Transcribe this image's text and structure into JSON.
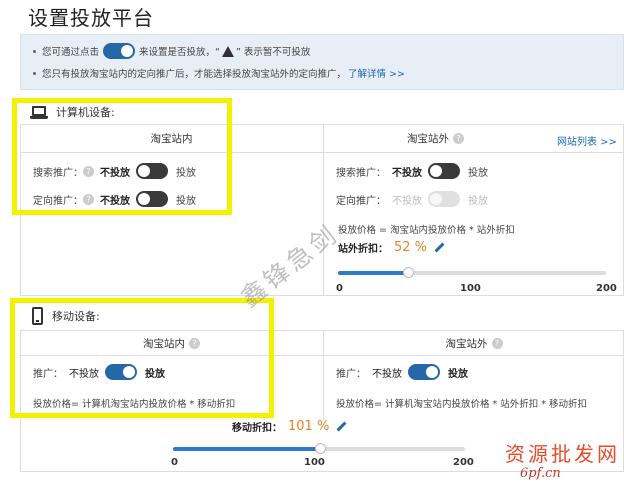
{
  "page": {
    "title": "设置投放平台"
  },
  "notice": {
    "line1_pre": "您可通过点击",
    "line1_post": "来设置是否投放，“",
    "line1_tail": "” 表示暂不可投放",
    "line2": "您只有投放淘宝站内的定向推广后，才能选择投放淘宝站外的定向推广，",
    "link": "了解详情 >>"
  },
  "computer": {
    "title": "计算机设备:",
    "inside": {
      "header": "淘宝站内",
      "search": {
        "label": "搜索推广：",
        "off_label": "不投放",
        "on_label": "投放",
        "state": "off"
      },
      "targeted": {
        "label": "定向推广：",
        "off_label": "不投放",
        "on_label": "投放",
        "state": "off"
      }
    },
    "outside": {
      "header": "淘宝站外",
      "site_list_link": "网站列表 >>",
      "search": {
        "label": "搜索推广：",
        "off_label": "不投放",
        "on_label": "投放",
        "state": "off"
      },
      "targeted": {
        "label": "定向推广：",
        "off_label": "不投放",
        "on_label": "投放",
        "state": "disabled"
      },
      "formula": "投放价格 = 淘宝站内投放价格 * 站外折扣",
      "discount_label": "站外折扣：",
      "discount_value": "52 %",
      "slider": {
        "min": "0",
        "mid": "100",
        "max": "200",
        "value": 52
      }
    }
  },
  "mobile": {
    "title": "移动设备:",
    "inside": {
      "header": "淘宝站内",
      "promo": {
        "label": "推广：",
        "off_label": "不投放",
        "on_label": "投放",
        "state": "on"
      },
      "formula": "投放价格= 计算机淘宝站内投放价格 * 移动折扣"
    },
    "outside": {
      "header": "淘宝站外",
      "promo": {
        "label": "推广：",
        "off_label": "不投放",
        "on_label": "投放",
        "state": "on"
      },
      "formula": "投放价格= 计算机淘宝站内投放价格 * 站外折扣 * 移动折扣"
    },
    "discount_label": "移动折扣：",
    "discount_value": "101 %",
    "slider": {
      "min": "0",
      "mid": "100",
      "max": "200",
      "value": 101
    }
  },
  "watermarks": {
    "diagonal": "鑫锋急剑",
    "brand": "资源批发网",
    "brand_url": "6pf.cn"
  },
  "colors": {
    "accent": "#2468a8",
    "highlight": "#f2f200",
    "discount": "#e8832a",
    "link": "#1a67b5"
  }
}
